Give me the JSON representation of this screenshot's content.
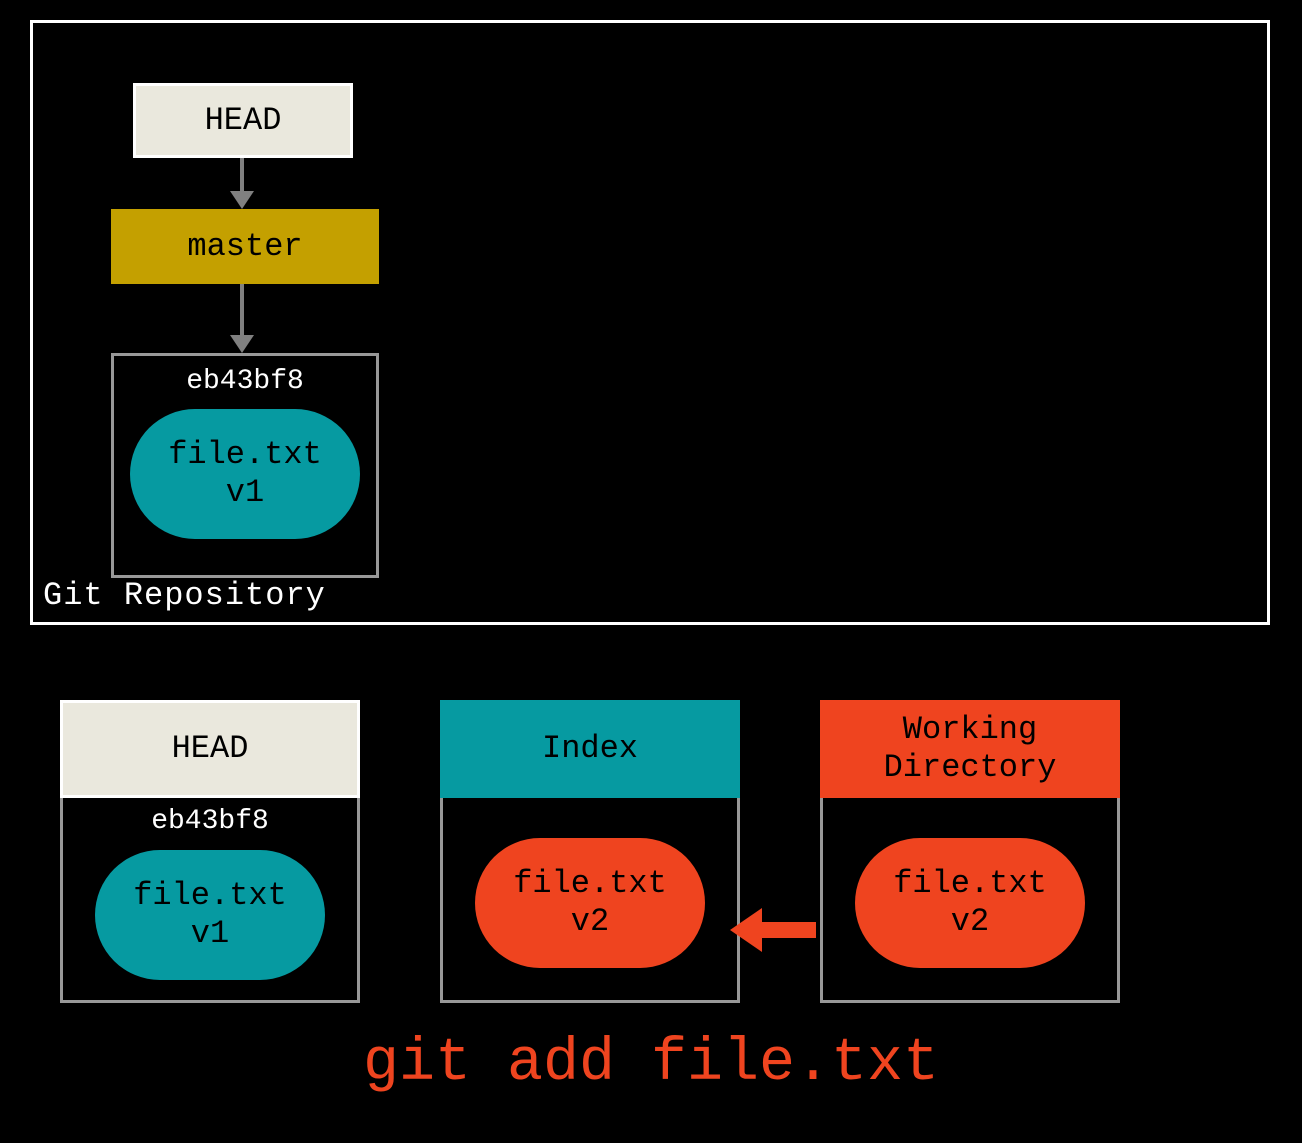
{
  "repo": {
    "label": "Git Repository",
    "head_label": "HEAD",
    "branch_label": "master",
    "commit": {
      "hash": "eb43bf8",
      "file_name": "file.txt",
      "file_version": "v1"
    }
  },
  "columns": {
    "head": {
      "title": "HEAD",
      "hash": "eb43bf8",
      "file_name": "file.txt",
      "file_version": "v1"
    },
    "index": {
      "title": "Index",
      "file_name": "file.txt",
      "file_version": "v2"
    },
    "wd": {
      "title": "Working Directory",
      "file_name": "file.txt",
      "file_version": "v2"
    }
  },
  "command": "git add file.txt",
  "colors": {
    "teal": "#069aa1",
    "orange": "#ef441f",
    "mustard": "#c4a000",
    "cream": "#eae8dd"
  }
}
